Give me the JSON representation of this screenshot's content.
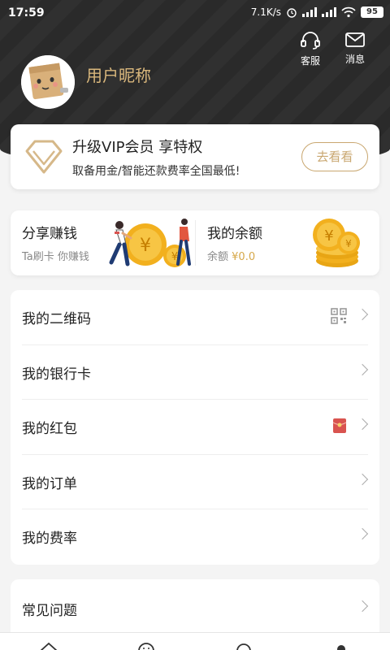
{
  "status_bar": {
    "time": "17:59",
    "speed": "7.1K/s",
    "battery": "95"
  },
  "header": {
    "service_label": "客服",
    "message_label": "消息",
    "nickname": "用户昵称"
  },
  "vip": {
    "title": "升级VIP会员 享特权",
    "subtitle": "取备用金/智能还款费率全国最低!",
    "button_label": "去看看"
  },
  "promo": {
    "share_title": "分享赚钱",
    "share_subtitle": "Ta刷卡 你赚钱",
    "balance_title": "我的余额",
    "balance_prefix": "余额",
    "balance_amount": "¥0.0"
  },
  "menu": {
    "items": [
      {
        "label": "我的二维码",
        "icon": "qr-code-icon"
      },
      {
        "label": "我的银行卡"
      },
      {
        "label": "我的红包",
        "icon": "red-envelope-icon"
      },
      {
        "label": "我的订单"
      },
      {
        "label": "我的费率"
      }
    ]
  },
  "faq": {
    "label": "常见问题"
  },
  "colors": {
    "gold": "#d9b77c",
    "button_gold": "#c9a770",
    "red_envelope": "#d9534f"
  }
}
